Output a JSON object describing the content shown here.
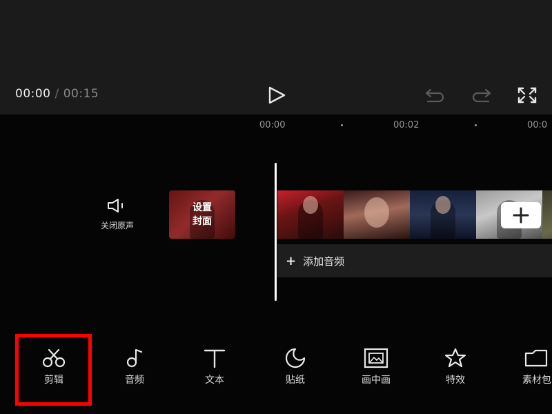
{
  "player": {
    "current_time": "00:00",
    "separator": "/",
    "total_time": "00:15"
  },
  "ruler": {
    "labels": [
      "00:00",
      "00:02",
      "00:0"
    ]
  },
  "track": {
    "mute_label": "关闭原声",
    "cover_label_line1": "设置",
    "cover_label_line2": "封面",
    "add_audio_label": "添加音频"
  },
  "toolbar": {
    "items": [
      {
        "label": "剪辑",
        "icon": "scissors-icon"
      },
      {
        "label": "音频",
        "icon": "music-note-icon"
      },
      {
        "label": "文本",
        "icon": "text-t-icon"
      },
      {
        "label": "贴纸",
        "icon": "sticker-icon"
      },
      {
        "label": "画中画",
        "icon": "picture-in-picture-icon"
      },
      {
        "label": "特效",
        "icon": "star-effect-icon"
      },
      {
        "label": "素材包",
        "icon": "folder-icon"
      }
    ],
    "highlighted_item": "剪辑"
  },
  "colors": {
    "highlight": "#ff0000",
    "background": "#050505",
    "preview_background": "#1b1b1b"
  }
}
